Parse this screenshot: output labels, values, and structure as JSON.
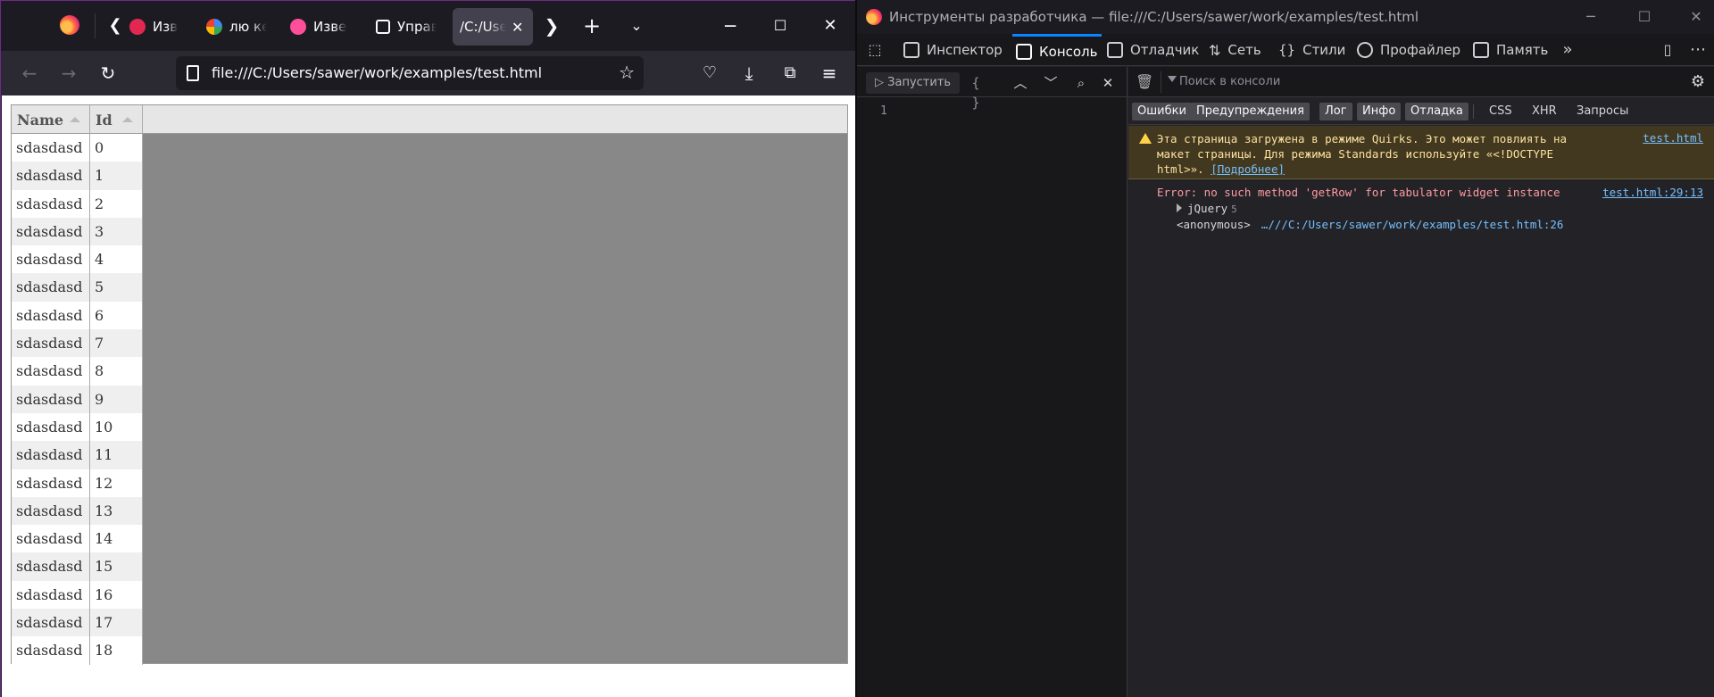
{
  "browser": {
    "tabs": [
      {
        "label": "Извес",
        "color": "#e22850"
      },
      {
        "label": "лю ке",
        "color": "#ffffff"
      },
      {
        "label": "Извес",
        "color": "#ff4f9a"
      },
      {
        "label": "Управ",
        "color": "#fbfbfe"
      },
      {
        "label": "/C:/Use",
        "color": "#fbfbfe"
      }
    ],
    "url": "file:///C:/Users/sawer/work/examples/test.html"
  },
  "table": {
    "headers": {
      "name": "Name",
      "id": "Id"
    },
    "rows": [
      {
        "name": "sdasdasd",
        "id": "0"
      },
      {
        "name": "sdasdasd",
        "id": "1"
      },
      {
        "name": "sdasdasd",
        "id": "2"
      },
      {
        "name": "sdasdasd",
        "id": "3"
      },
      {
        "name": "sdasdasd",
        "id": "4"
      },
      {
        "name": "sdasdasd",
        "id": "5"
      },
      {
        "name": "sdasdasd",
        "id": "6"
      },
      {
        "name": "sdasdasd",
        "id": "7"
      },
      {
        "name": "sdasdasd",
        "id": "8"
      },
      {
        "name": "sdasdasd",
        "id": "9"
      },
      {
        "name": "sdasdasd",
        "id": "10"
      },
      {
        "name": "sdasdasd",
        "id": "11"
      },
      {
        "name": "sdasdasd",
        "id": "12"
      },
      {
        "name": "sdasdasd",
        "id": "13"
      },
      {
        "name": "sdasdasd",
        "id": "14"
      },
      {
        "name": "sdasdasd",
        "id": "15"
      },
      {
        "name": "sdasdasd",
        "id": "16"
      },
      {
        "name": "sdasdasd",
        "id": "17"
      },
      {
        "name": "sdasdasd",
        "id": "18"
      }
    ]
  },
  "devtools": {
    "title": "Инструменты разработчика — file:///C:/Users/sawer/work/examples/test.html",
    "tabs": {
      "inspector": "Инспектор",
      "console": "Консоль",
      "debugger": "Отладчик",
      "network": "Сеть",
      "styles": "Стили",
      "profiler": "Профайлер",
      "memory": "Память"
    },
    "editor": {
      "run_label": "Запустить",
      "line_number": "1"
    },
    "console": {
      "filter_placeholder": "Поиск в консоли",
      "filters": {
        "errors": "Ошибки",
        "warnings": "Предупреждения",
        "log": "Лог",
        "info": "Инфо",
        "debug": "Отладка",
        "css": "CSS",
        "xhr": "XHR",
        "requests": "Запросы"
      },
      "warning": {
        "line1": "Эта страница загружена в режиме Quirks. Это может повлиять на",
        "line2": "макет страницы. Для режима Standards используйте «<!DOCTYPE",
        "line3": "html>».",
        "learn_more": "[Подробнее]",
        "source": "test.html"
      },
      "error": {
        "message": "Error: no such method 'getRow' for tabulator widget instance",
        "source": "test.html:29:13",
        "trace1_name": "jQuery",
        "trace1_count": "5",
        "trace2_name": "<anonymous>",
        "trace2_loc": "…///C:/Users/sawer/work/examples/test.html:26"
      }
    }
  }
}
